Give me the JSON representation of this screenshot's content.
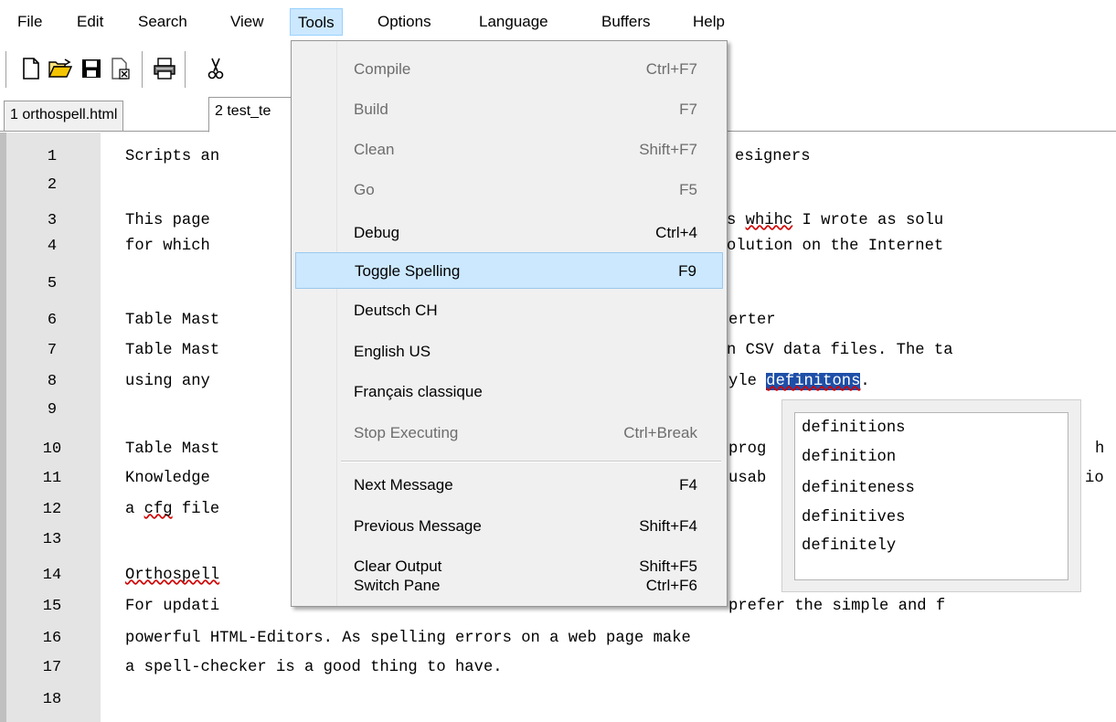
{
  "menubar": {
    "items": [
      "File",
      "Edit",
      "Search",
      "View",
      "Tools",
      "Options",
      "Language",
      "Buffers",
      "Help"
    ]
  },
  "tabs": [
    "1 orthospell.html",
    "2 test_te"
  ],
  "editor": {
    "line_numbers": [
      "1",
      "2",
      "3",
      "4",
      "5",
      "6",
      "7",
      "8",
      "9",
      "10",
      "11",
      "12",
      "13",
      "14",
      "15",
      "16",
      "17",
      "18"
    ],
    "lines": {
      "l1": "Scripts an",
      "l1b": "esigners",
      "l3": "This page",
      "l3b": "s ",
      "l3c": "whihc",
      "l3d": " I wrote as solu",
      "l4": "for which",
      "l4b": "olution on the Internet",
      "l6": "Table Mast",
      "l6b": "erter",
      "l7": "Table Mast",
      "l7b": "n CSV data files. The ta",
      "l8": "using any",
      "l8b": "yle ",
      "l8c": "definitons",
      "l8d": ".",
      "l10": "Table Mast",
      "l10b": "prog",
      "l10c": "h",
      "l11": "Knowledge",
      "l11b": "usab",
      "l11c": "io",
      "l12a": "a ",
      "l12b": "cfg",
      "l12c": " file",
      "l14": "Orthospell",
      "l15": "For updati",
      "l15b": "prefer the simple and f",
      "l16": "powerful HTML-Editors. As spelling errors on a web page make",
      "l17": "a spell-checker is a good thing to have."
    }
  },
  "tools_menu": {
    "items": [
      {
        "label": "Compile",
        "shortcut": "Ctrl+F7"
      },
      {
        "label": "Build",
        "shortcut": "F7"
      },
      {
        "label": "Clean",
        "shortcut": "Shift+F7"
      },
      {
        "label": "Go",
        "shortcut": "F5"
      },
      {
        "label": "Debug",
        "shortcut": "Ctrl+4"
      },
      {
        "label": "Toggle Spelling",
        "shortcut": "F9"
      },
      {
        "label": "Deutsch CH",
        "shortcut": ""
      },
      {
        "label": "English US",
        "shortcut": ""
      },
      {
        "label": "Français classique",
        "shortcut": ""
      },
      {
        "label": "Stop Executing",
        "shortcut": "Ctrl+Break"
      },
      {
        "label": "Next Message",
        "shortcut": "F4"
      },
      {
        "label": "Previous Message",
        "shortcut": "Shift+F4"
      },
      {
        "label": "Clear Output",
        "shortcut": "Shift+F5"
      },
      {
        "label": "Switch Pane",
        "shortcut": "Ctrl+F6"
      }
    ]
  },
  "suggestions": [
    "definitions",
    "definition",
    "definiteness",
    "definitives",
    "definitely"
  ]
}
